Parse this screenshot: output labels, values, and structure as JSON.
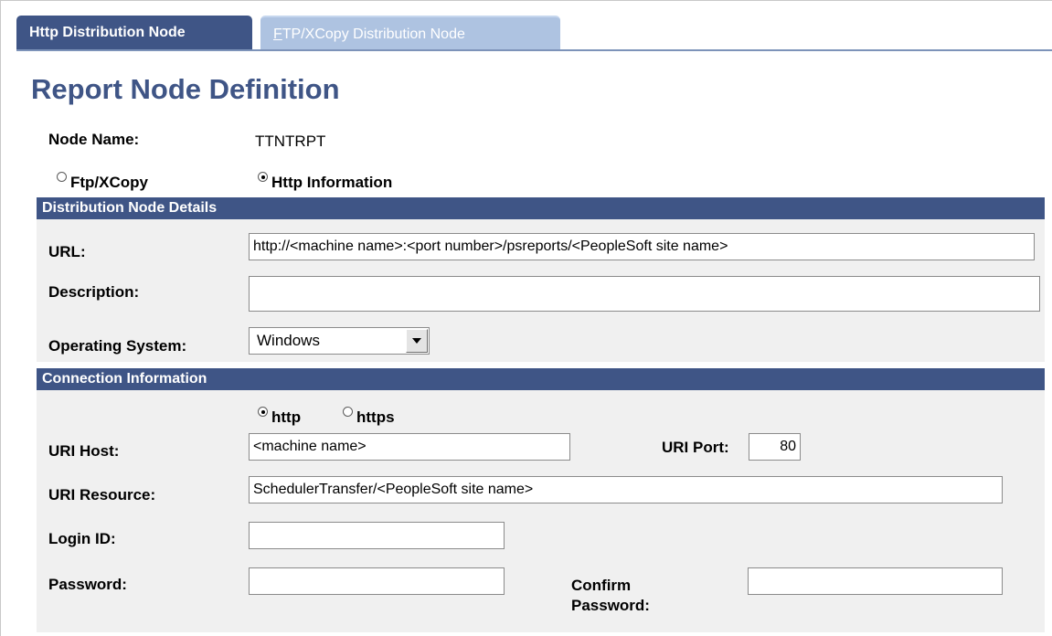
{
  "tabs": {
    "active": "Http Distribution Node",
    "inactive_accel": "F",
    "inactive_rest": "TP/XCopy Distribution Node"
  },
  "page_title": "Report Node Definition",
  "node": {
    "label": "Node Name:",
    "value": "TTNTRPT"
  },
  "mode": {
    "ftp_label": "Ftp/XCopy",
    "http_label": "Http Information",
    "selected": "Http Information"
  },
  "details": {
    "header": "Distribution Node Details",
    "url_label": "URL:",
    "url_value": "http://<machine name>:<port number>/psreports/<PeopleSoft site name>",
    "description_label": "Description:",
    "description_value": "",
    "os_label": "Operating System:",
    "os_value": "Windows"
  },
  "connection": {
    "header": "Connection Information",
    "http_label": "http",
    "https_label": "https",
    "selected_protocol": "http",
    "host_label": "URI Host:",
    "host_value": "<machine name>",
    "port_label": "URI Port:",
    "port_value": "80",
    "resource_label": "URI Resource:",
    "resource_value": "SchedulerTransfer/<PeopleSoft site name>",
    "login_label": "Login ID:",
    "login_value": "",
    "password_label": "Password:",
    "password_value": "",
    "confirm_label_1": "Confirm",
    "confirm_label_2": "Password:",
    "confirm_value": ""
  }
}
